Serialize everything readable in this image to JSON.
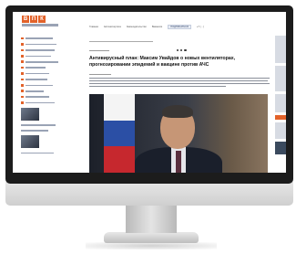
{
  "logo": {
    "letters": [
      "В",
      "П",
      "К"
    ]
  },
  "nav": {
    "items": [
      "Главная",
      "Автоэкспертиза",
      "Законодательство",
      "Вакансии"
    ],
    "subscribe": "ПОДПИСАТЬСЯ",
    "phone": "+7 (…)"
  },
  "article": {
    "title": "Антивирусный план: Максим Увайдов о новых вентиляторах, прогнозировании эпидемий и вакцине против АЧС"
  },
  "colors": {
    "accent": "#e2622a",
    "bezel": "#1c1c1c",
    "flag": [
      "#ffffff",
      "#2b4fa5",
      "#c6282e"
    ]
  }
}
